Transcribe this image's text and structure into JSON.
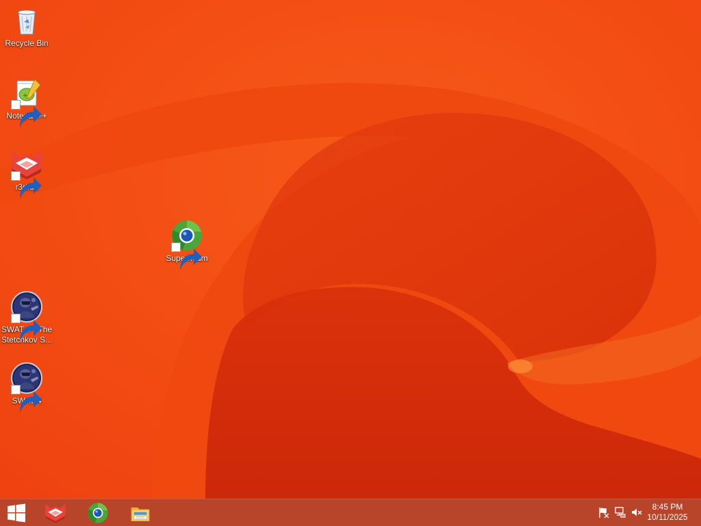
{
  "desktop": {
    "icons": [
      {
        "label": "Recycle Bin",
        "icon": "recycle-bin-icon",
        "shortcut": false
      },
      {
        "label": "Notepad++",
        "icon": "notepad-plus-plus-icon",
        "shortcut": true
      },
      {
        "label": "r3dfox",
        "icon": "r3dfox-icon",
        "shortcut": true
      },
      {
        "label": "Supermium",
        "icon": "supermium-icon",
        "shortcut": true
      },
      {
        "label": "SWAT 4 - The Stetchkov S...",
        "icon": "swat4-icon",
        "shortcut": true
      },
      {
        "label": "SWAT 4",
        "icon": "swat4-icon",
        "shortcut": true
      }
    ]
  },
  "taskbar": {
    "start_icon": "windows-logo-icon",
    "pinned": [
      {
        "icon": "r3dfox-icon"
      },
      {
        "icon": "supermium-icon"
      },
      {
        "icon": "file-explorer-icon"
      }
    ],
    "tray": [
      {
        "icon": "action-center-flag-icon"
      },
      {
        "icon": "network-icon"
      },
      {
        "icon": "volume-muted-icon"
      }
    ],
    "clock": {
      "time": "8:45 PM",
      "date": "10/11/2025"
    }
  },
  "colors": {
    "wallpaper_base": "#f24a12",
    "wallpaper_dark": "#d32a0a",
    "taskbar": "#b8442a"
  }
}
